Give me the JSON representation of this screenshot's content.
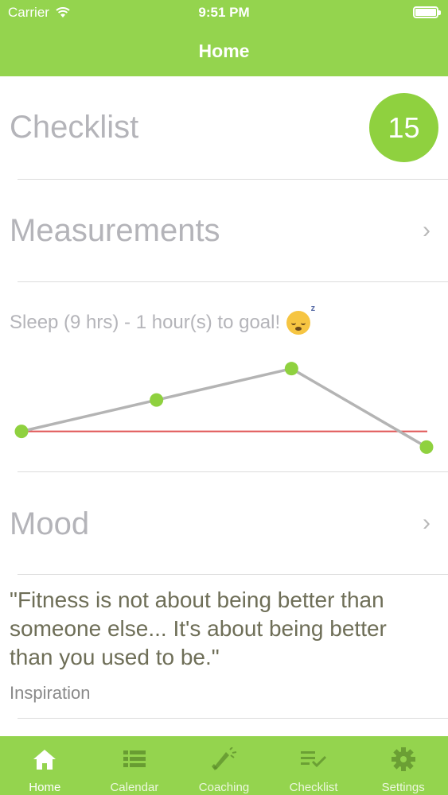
{
  "status_bar": {
    "carrier": "Carrier",
    "time": "9:51 PM",
    "icons": [
      "wifi-icon",
      "battery-icon"
    ]
  },
  "nav": {
    "title": "Home"
  },
  "checklist": {
    "title": "Checklist",
    "badge": "15"
  },
  "measurements": {
    "title": "Measurements",
    "chevron": "›"
  },
  "sleep": {
    "label": "Sleep (9 hrs) - 1 hour(s) to goal!",
    "emoji": "sleeping-face-icon"
  },
  "chart_data": {
    "type": "line",
    "x": [
      1,
      2,
      3,
      4
    ],
    "series": [
      {
        "values": [
          8,
          9,
          10,
          7.5
        ],
        "color": "#b4b4b4"
      }
    ],
    "goal_line": {
      "value": 8,
      "color": "#e05555"
    },
    "point_color": "#8fd13f",
    "ylim": [
      6.8,
      10.6
    ],
    "grid": false,
    "title": "",
    "xlabel": "",
    "ylabel": ""
  },
  "mood": {
    "title": "Mood",
    "chevron": "›"
  },
  "inspiration": {
    "quote": "\"Fitness is not about being better than someone else... It's about being better than you used to be.\"",
    "source": "Inspiration"
  },
  "tabs": [
    {
      "label": "Home",
      "icon": "home-icon",
      "active": true
    },
    {
      "label": "Calendar",
      "icon": "list-icon",
      "active": false
    },
    {
      "label": "Coaching",
      "icon": "megaphone-icon",
      "active": false
    },
    {
      "label": "Checklist",
      "icon": "checklist-icon",
      "active": false
    },
    {
      "label": "Settings",
      "icon": "gear-icon",
      "active": false
    }
  ],
  "colors": {
    "accent": "#94d44e",
    "badge": "#8fd13f",
    "muted_text": "#b4b4b9",
    "quote_text": "#6e6e57"
  }
}
